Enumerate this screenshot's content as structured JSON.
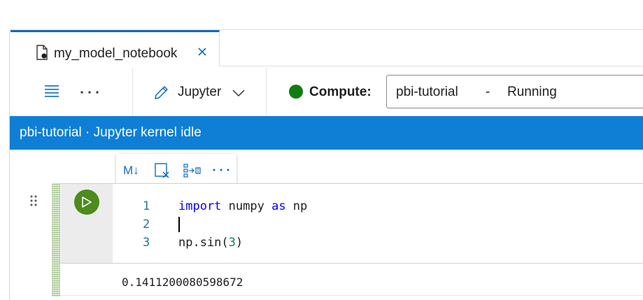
{
  "tab": {
    "title": "my_model_notebook",
    "file_icon": "notebook-file-icon",
    "close_icon": "close-icon"
  },
  "toolbar": {
    "menu_icon": "hamburger-menu-icon",
    "more_icon": "more-options-icon",
    "kernel": {
      "icon": "pencil-icon",
      "label": "Jupyter",
      "dropdown_icon": "chevron-down-icon"
    },
    "compute": {
      "label": "Compute:",
      "status_color": "#107c10",
      "name": "pbi-tutorial",
      "separator": "-",
      "status": "Running"
    }
  },
  "status_bar": {
    "text": "pbi-tutorial · Jupyter kernel idle",
    "color": "#0f7fd6"
  },
  "cell_toolbar": {
    "markdown_label": "M↓",
    "icons": [
      "clear-output-icon",
      "split-cell-icon",
      "more-options-icon"
    ]
  },
  "cell": {
    "lines": [
      {
        "number": "1",
        "code": "import numpy as np"
      },
      {
        "number": "2",
        "code": ""
      },
      {
        "number": "3",
        "code": "np.sin(3)"
      }
    ],
    "run_icon": "run-triangle-icon",
    "run_color": "#4c8b1c",
    "output": "0.1411200080598672"
  }
}
